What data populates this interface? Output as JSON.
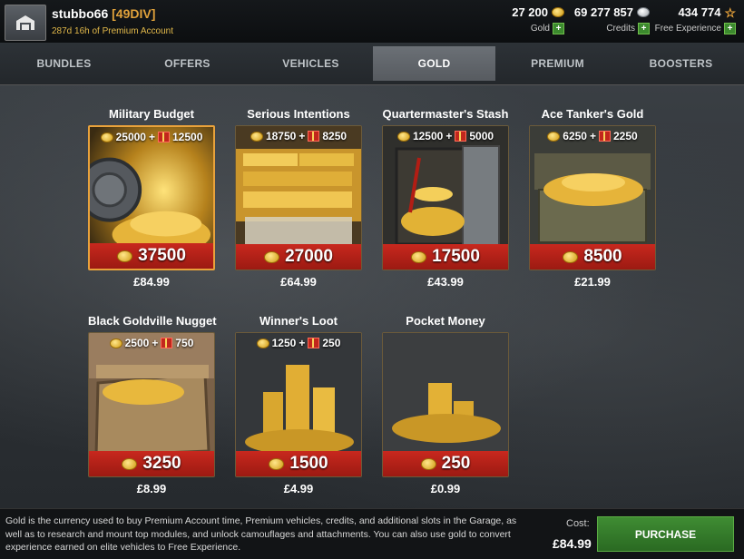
{
  "player": {
    "name": "stubbo66",
    "clan": "[49DIV]",
    "premium_time": "287d 16h of Premium Account"
  },
  "resources": {
    "gold": {
      "value": "27 200",
      "label": "Gold"
    },
    "credits": {
      "value": "69 277 857",
      "label": "Credits"
    },
    "free_xp": {
      "value": "434 774",
      "label": "Free Experience"
    },
    "plus_symbol": "+"
  },
  "tabs": [
    {
      "label": "BUNDLES"
    },
    {
      "label": "OFFERS"
    },
    {
      "label": "VEHICLES"
    },
    {
      "label": "GOLD",
      "active": true
    },
    {
      "label": "PREMIUM"
    },
    {
      "label": "BOOSTERS"
    }
  ],
  "packs": [
    {
      "title": "Military Budget",
      "base": "25000",
      "bonus": "12500",
      "total": "37500",
      "price": "£84.99",
      "selected": true
    },
    {
      "title": "Serious Intentions",
      "base": "18750",
      "bonus": "8250",
      "total": "27000",
      "price": "£64.99"
    },
    {
      "title": "Quartermaster's Stash",
      "base": "12500",
      "bonus": "5000",
      "total": "17500",
      "price": "£43.99"
    },
    {
      "title": "Ace Tanker's Gold",
      "base": "6250",
      "bonus": "2250",
      "total": "8500",
      "price": "£21.99"
    },
    {
      "title": "Black Goldville Nugget",
      "base": "2500",
      "bonus": "750",
      "total": "3250",
      "price": "£8.99"
    },
    {
      "title": "Winner's Loot",
      "base": "1250",
      "bonus": "250",
      "total": "1500",
      "price": "£4.99"
    },
    {
      "title": "Pocket Money",
      "base": "",
      "bonus": "",
      "total": "250",
      "price": "£0.99"
    }
  ],
  "plus_sign": "+",
  "footer": {
    "description": "Gold is the currency used to buy Premium Account time, Premium vehicles, credits, and additional slots in the Garage, as well as to research and mount top modules, and unlock camouflages and attachments. You can also use gold to convert experience earned on elite vehicles to Free Experience.",
    "cost_label": "Cost:",
    "cost_value": "£84.99",
    "purchase_label": "PURCHASE"
  },
  "colors": {
    "accent_gold": "#e9a23b",
    "price_bar_red": "#c8281e",
    "purchase_green": "#3f8c33"
  }
}
